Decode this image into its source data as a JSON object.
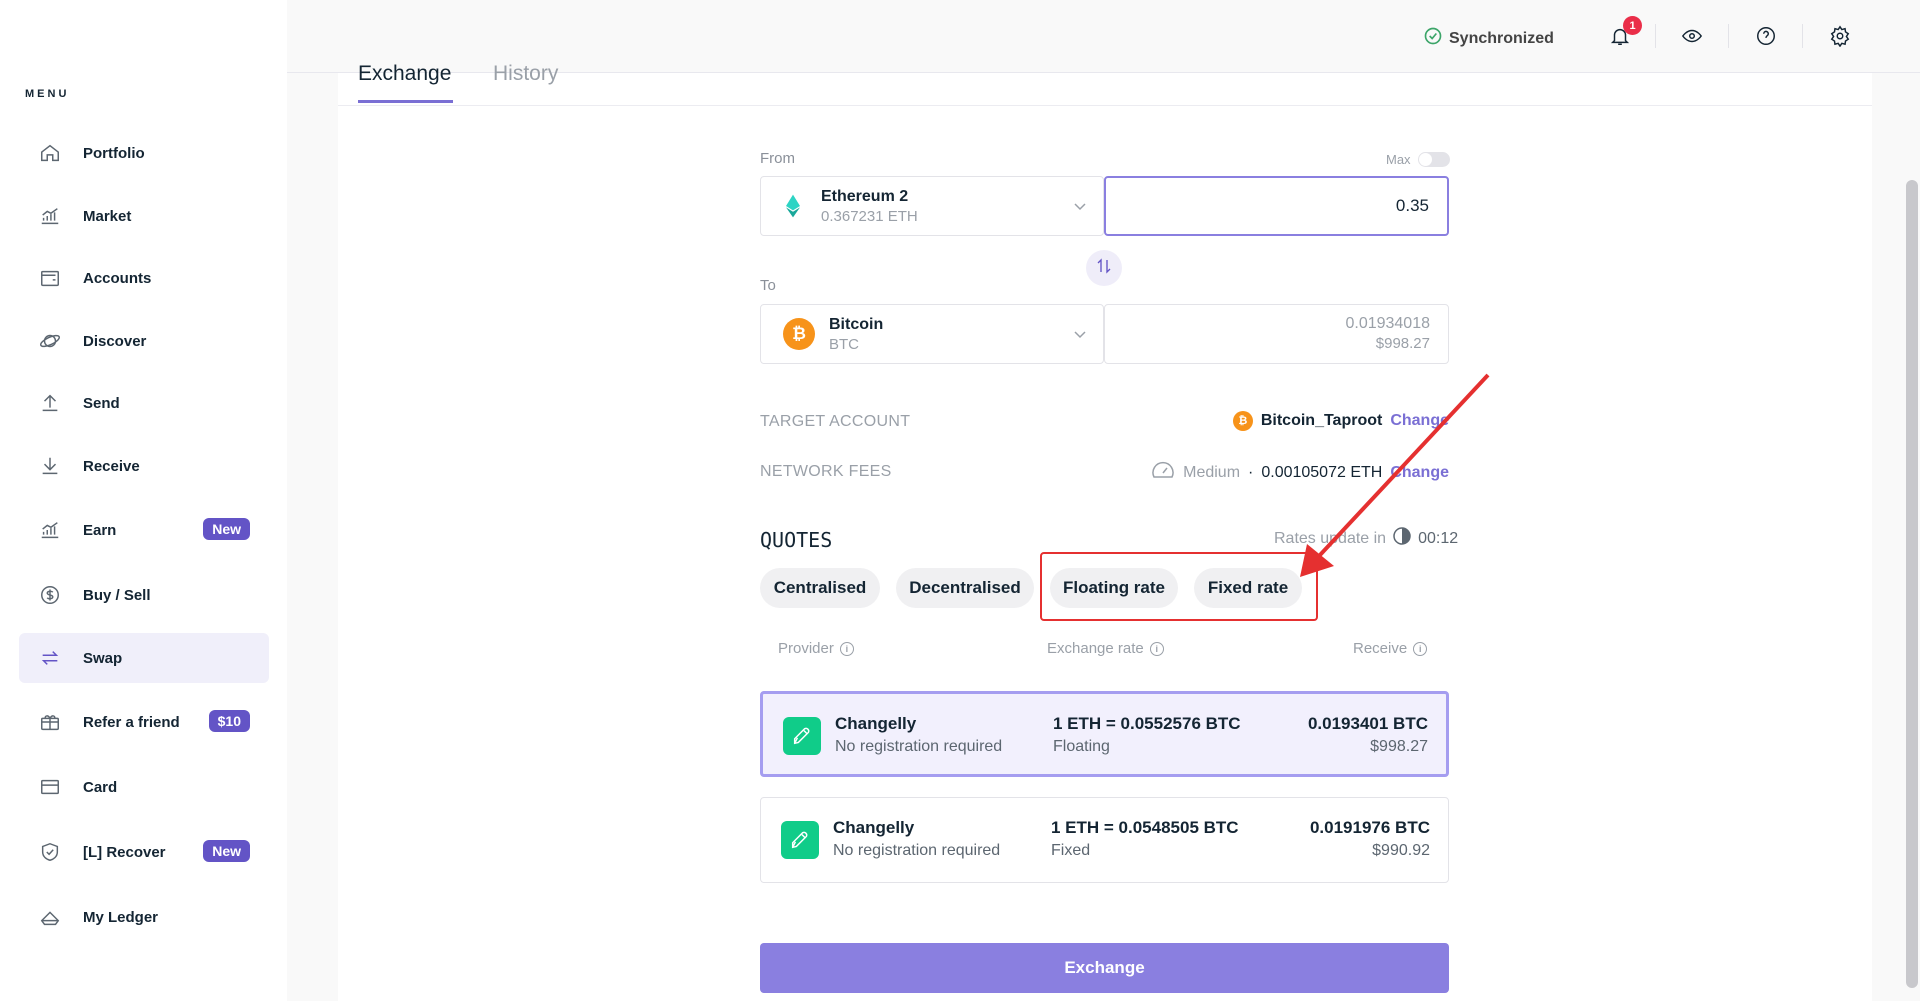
{
  "sidebar": {
    "menu_title": "MENU",
    "items": [
      {
        "label": "Portfolio",
        "icon": "home-icon"
      },
      {
        "label": "Market",
        "icon": "chart-icon"
      },
      {
        "label": "Accounts",
        "icon": "wallet-icon"
      },
      {
        "label": "Discover",
        "icon": "planet-icon"
      },
      {
        "label": "Send",
        "icon": "upload-icon"
      },
      {
        "label": "Receive",
        "icon": "download-icon"
      },
      {
        "label": "Earn",
        "icon": "chart-icon",
        "badge": "New"
      },
      {
        "label": "Buy / Sell",
        "icon": "dollar-icon"
      },
      {
        "label": "Swap",
        "icon": "swap-icon",
        "active": true
      },
      {
        "label": "Refer a friend",
        "icon": "gift-icon",
        "badge": "$10"
      },
      {
        "label": "Card",
        "icon": "card-icon"
      },
      {
        "label": "[L] Recover",
        "icon": "shield-icon",
        "badge": "New"
      },
      {
        "label": "My Ledger",
        "icon": "ledger-icon"
      }
    ]
  },
  "topbar": {
    "sync_label": "Synchronized",
    "notification_count": "1"
  },
  "tabs": {
    "exchange": "Exchange",
    "history": "History"
  },
  "from": {
    "label": "From",
    "max_label": "Max",
    "coin_name": "Ethereum 2",
    "coin_balance": "0.367231 ETH",
    "amount": "0.35"
  },
  "to": {
    "label": "To",
    "coin_name": "Bitcoin",
    "coin_ticker": "BTC",
    "amount": "0.01934018",
    "amount_usd": "$998.27"
  },
  "target_account": {
    "label": "TARGET ACCOUNT",
    "account_name": "Bitcoin_Taproot",
    "change": "Change"
  },
  "network_fees": {
    "label": "NETWORK FEES",
    "speed": "Medium",
    "separator": "·",
    "fee": "0.00105072 ETH",
    "change": "Change"
  },
  "quotes": {
    "title": "QUOTES",
    "rates_update_label": "Rates update in",
    "countdown": "00:12",
    "filters": [
      "Centralised",
      "Decentralised",
      "Floating rate",
      "Fixed rate"
    ],
    "columns": [
      "Provider",
      "Exchange rate",
      "Receive"
    ],
    "rows": [
      {
        "provider": "Changelly",
        "sub": "No registration required",
        "rate": "1 ETH = 0.0552576 BTC",
        "rate_type": "Floating",
        "receive": "0.0193401 BTC",
        "receive_usd": "$998.27",
        "selected": true
      },
      {
        "provider": "Changelly",
        "sub": "No registration required",
        "rate": "1 ETH = 0.0548505 BTC",
        "rate_type": "Fixed",
        "receive": "0.0191976 BTC",
        "receive_usd": "$990.92",
        "selected": false
      }
    ]
  },
  "exchange_button": "Exchange",
  "colors": {
    "accent": "#7a6fd4",
    "badge": "#6354c6",
    "notification": "#ea2e49",
    "annotation": "#e53030",
    "changelly": "#10cc89",
    "bitcoin": "#f7931a"
  }
}
